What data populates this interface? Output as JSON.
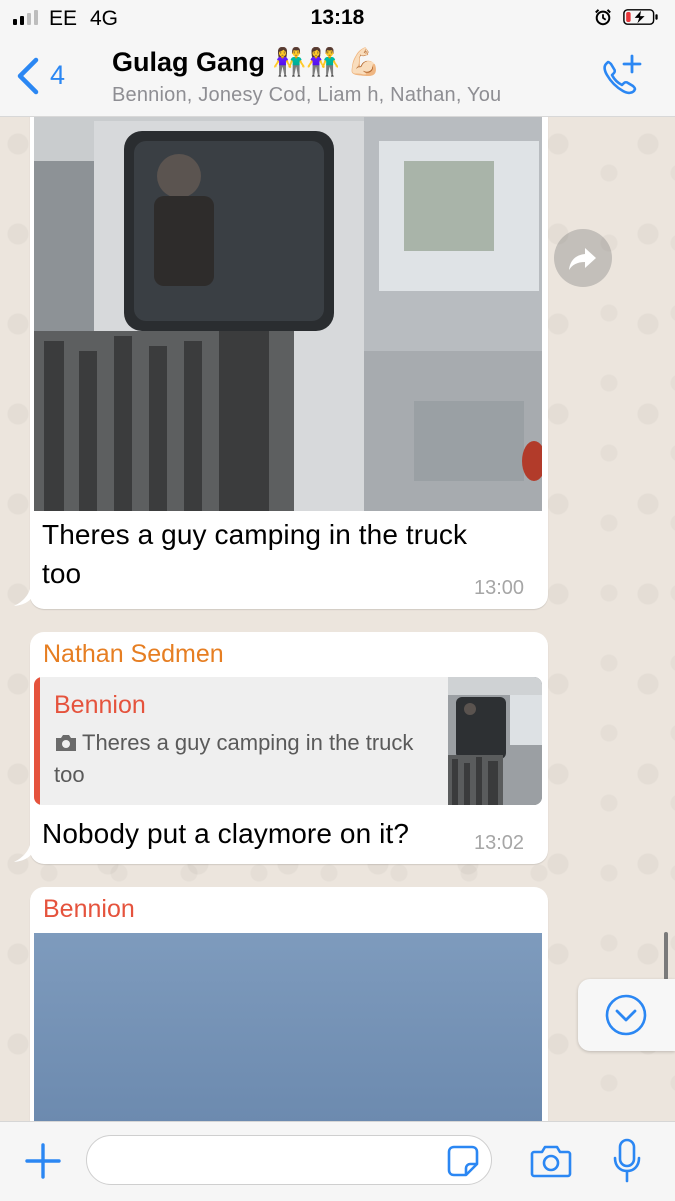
{
  "status_bar": {
    "carrier": "EE",
    "network": "4G",
    "time": "13:18",
    "alarm_icon": "alarm-clock-icon",
    "battery_icon": "battery-low-charging-icon"
  },
  "nav": {
    "back_count": "4",
    "title": "Gulag Gang 👫👫 💪🏻",
    "subtitle": "Bennion, Jonesy Cod, Liam h, Nathan, You",
    "call_icon": "add-call-icon"
  },
  "messages": [
    {
      "type": "image",
      "text_line1": "Theres a guy camping in the truck",
      "text_line2": "too",
      "time": "13:00"
    },
    {
      "type": "reply",
      "sender": "Nathan Sedmen",
      "sender_color": "#e67e22",
      "quote": {
        "name": "Bennion",
        "name_color": "#e5533d",
        "text": "Theres a guy camping in the truck too"
      },
      "text": "Nobody put a claymore on it?",
      "time": "13:02"
    },
    {
      "type": "image",
      "sender": "Bennion",
      "sender_color": "#e5533d"
    }
  ],
  "input": {
    "placeholder": ""
  },
  "colors": {
    "accent": "#2b87f3",
    "chat_bg": "#ece5dd"
  }
}
